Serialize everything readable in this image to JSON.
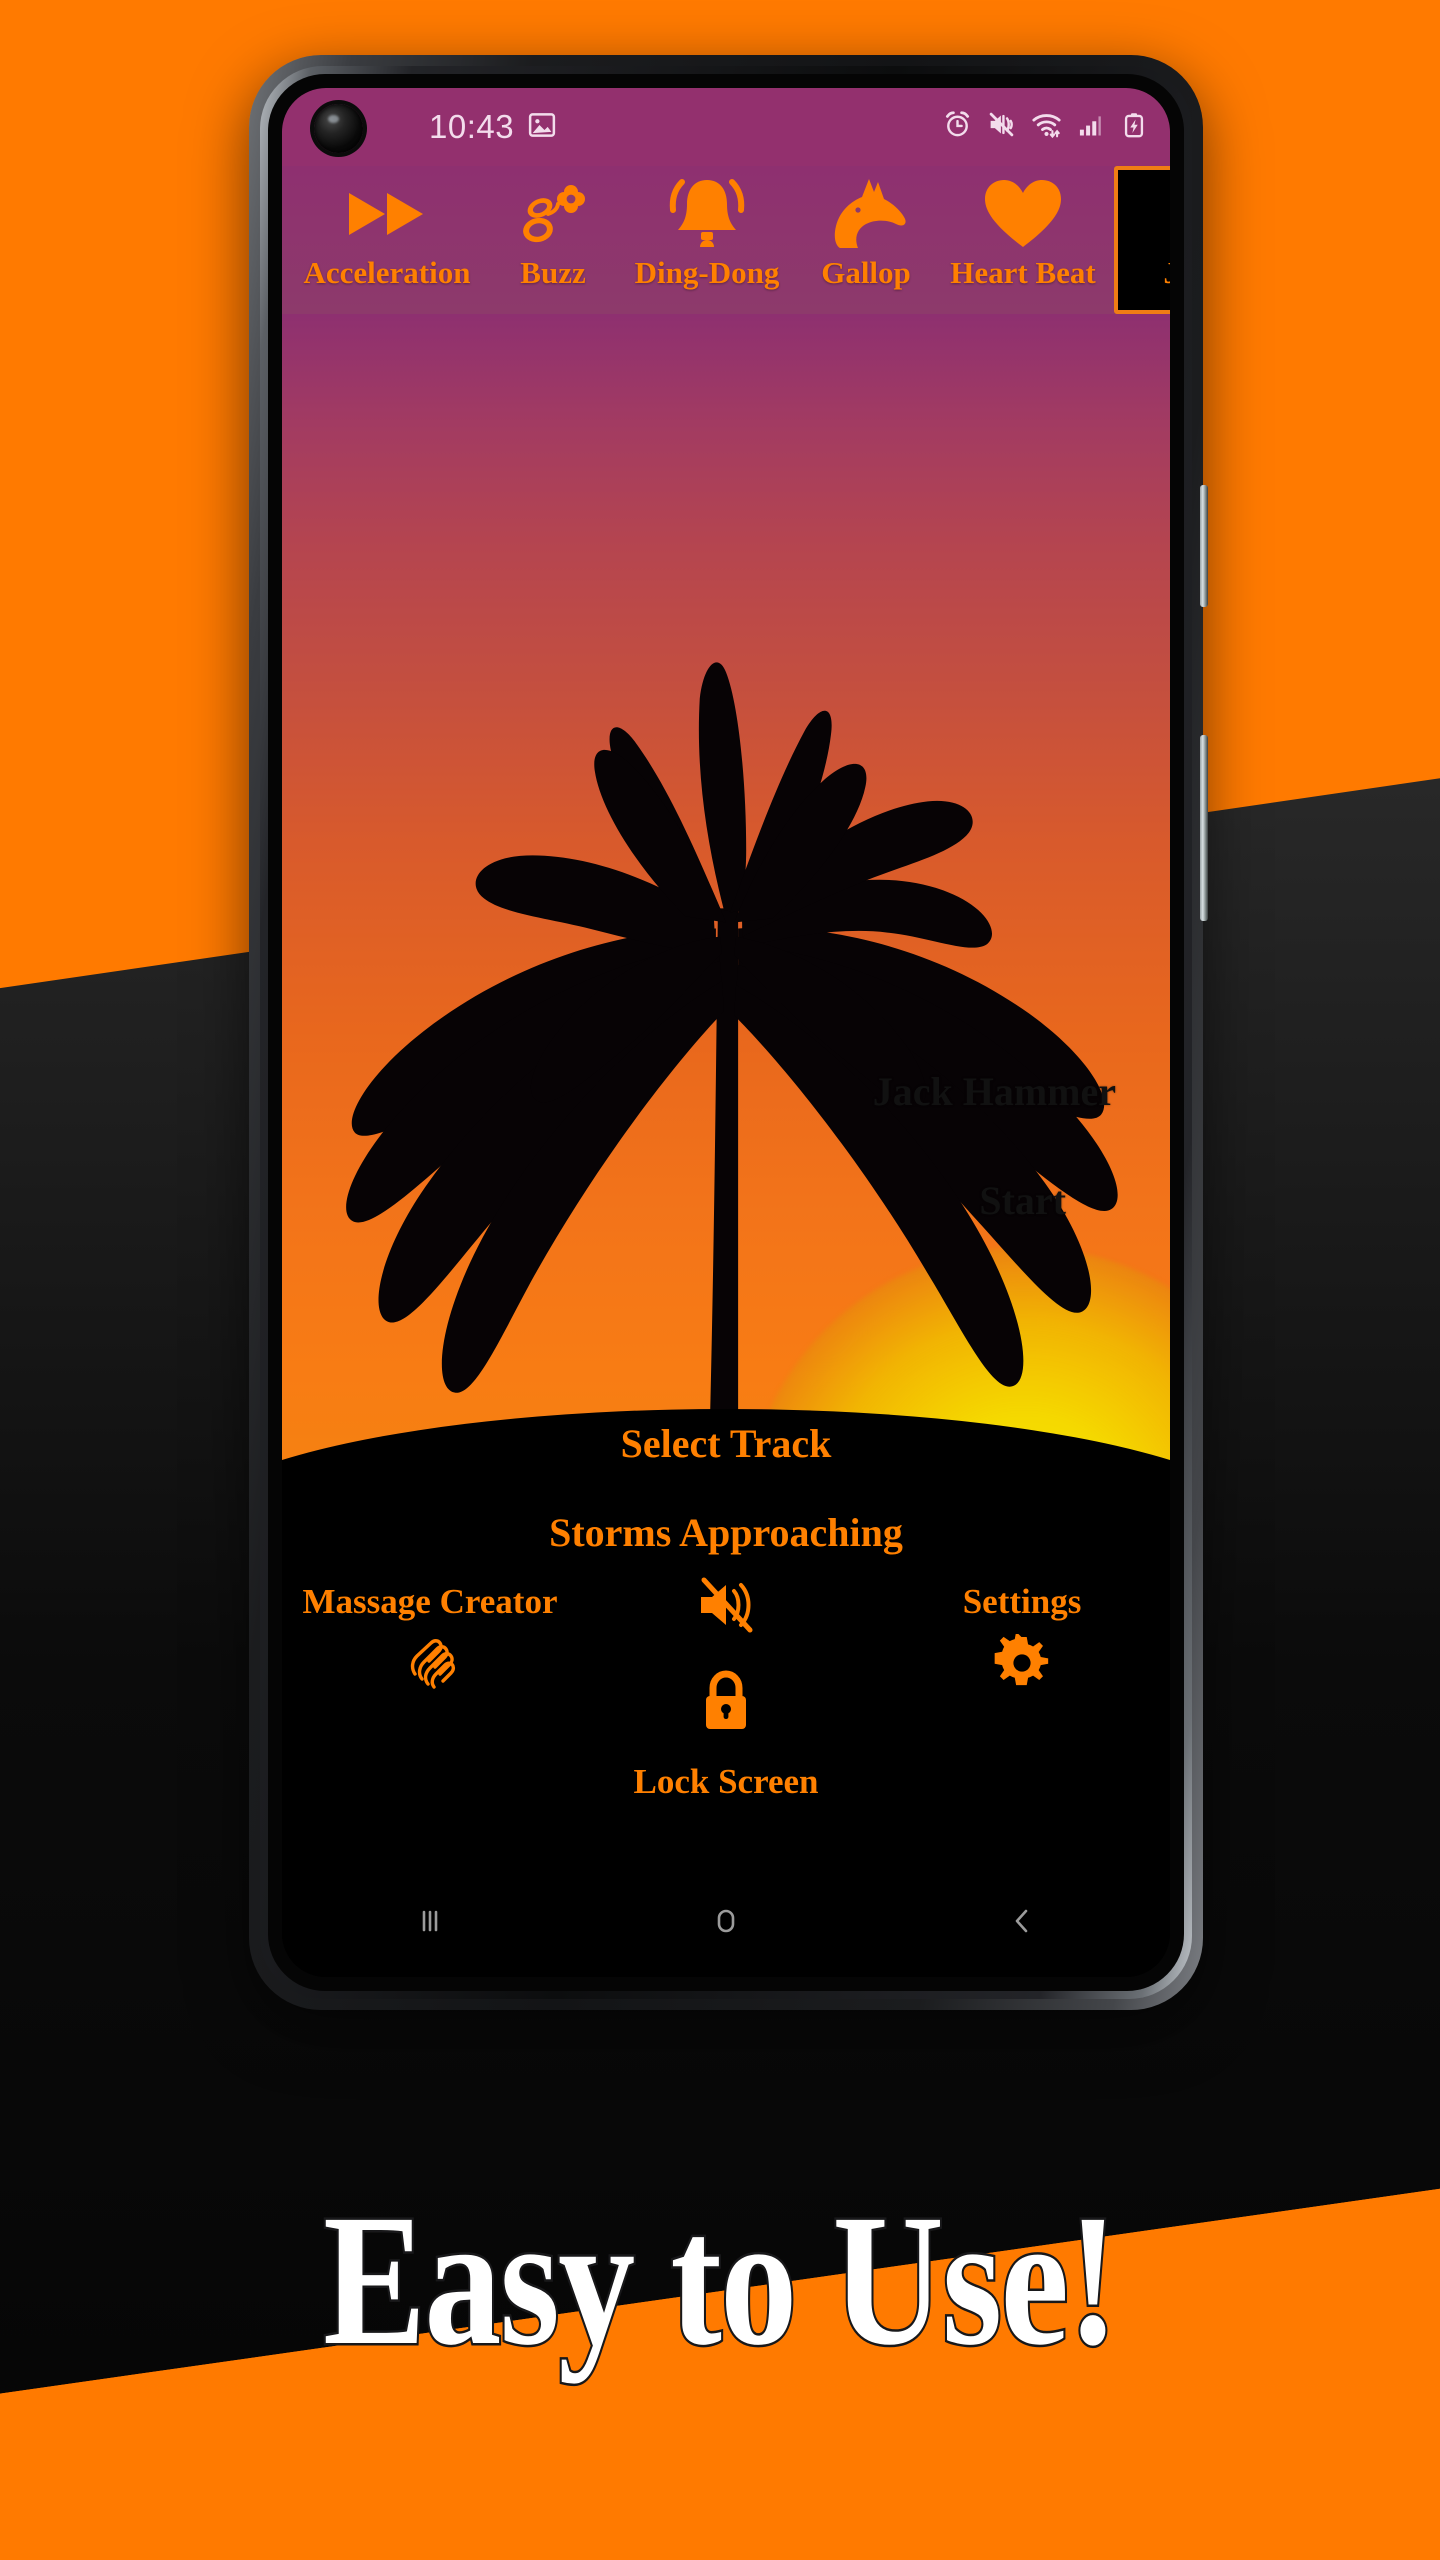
{
  "promo": {
    "headline": "Easy to Use!",
    "bg_color": "#ff7a00",
    "band_color": "#2a2a2a",
    "accent": "#ff8000"
  },
  "phone": {
    "status_bar": {
      "time": "10:43",
      "left_icons": [
        "image-icon"
      ],
      "right_icons": [
        "alarm-icon",
        "vibrate-mute-icon",
        "wifi-icon",
        "signal-icon",
        "battery-charging-icon"
      ],
      "bg_color": "#93306e",
      "text_color": "#f3dcec"
    },
    "tabs": [
      {
        "label": "Acceleration",
        "icon": "fast-forward-icon",
        "selected": false
      },
      {
        "label": "Buzz",
        "icon": "bee-flower-icon",
        "selected": false
      },
      {
        "label": "Ding-Dong",
        "icon": "bell-icon",
        "selected": false
      },
      {
        "label": "Gallop",
        "icon": "horse-head-icon",
        "selected": false
      },
      {
        "label": "Heart Beat",
        "icon": "heart-icon",
        "selected": false
      },
      {
        "label": "Ja",
        "icon": "jack-hammer-icon",
        "selected": true
      }
    ],
    "wallpaper": {
      "scene": "palm-tree-sunset",
      "sky_top": "#8e3070",
      "sky_mid": "#e8671d",
      "sky_bottom": "#f4840f",
      "sun_color": "#f7e400",
      "ground_color": "#000000"
    },
    "overlay": {
      "track_title": "Jack Hammer",
      "start_label": "Start"
    },
    "panel": {
      "select_track_label": "Select Track",
      "current_track": "Storms Approaching",
      "controls": [
        {
          "label": "Massage Creator",
          "icon": "massage-hand-icon"
        },
        {
          "label": "Lock Screen",
          "icon": "lock-icon"
        },
        {
          "label": "Settings",
          "icon": "gear-icon"
        }
      ],
      "mute_icon": "volume-off-icon",
      "accent": "#ff8000"
    },
    "nav_bar": {
      "recents": "recents-icon",
      "home": "home-icon",
      "back": "back-icon"
    }
  }
}
